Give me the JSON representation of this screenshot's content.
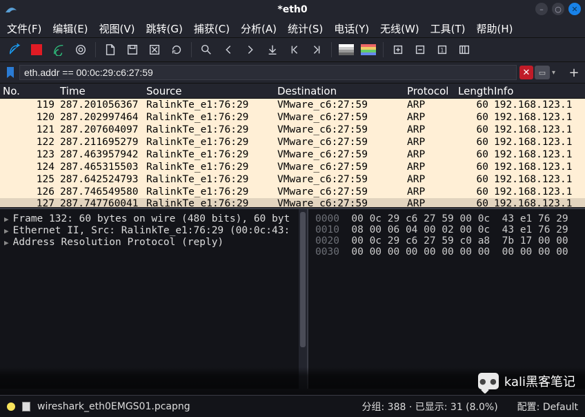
{
  "window": {
    "title": "*eth0"
  },
  "menu": {
    "file": "文件(F)",
    "edit": "编辑(E)",
    "view": "视图(V)",
    "goto": "跳转(G)",
    "capture": "捕获(C)",
    "analyze": "分析(A)",
    "stats": "统计(S)",
    "telephony": "电话(Y)",
    "wireless": "无线(W)",
    "tools": "工具(T)",
    "help": "帮助(H)"
  },
  "filter": {
    "value": "eth.addr == 00:0c:29:c6:27:59"
  },
  "columns": {
    "no": "No.",
    "time": "Time",
    "source": "Source",
    "destination": "Destination",
    "protocol": "Protocol",
    "length": "Length",
    "info": "Info"
  },
  "packets": [
    {
      "no": "119",
      "time": "287.201056367",
      "src": "RalinkTe_e1:76:29",
      "dst": "VMware_c6:27:59",
      "proto": "ARP",
      "len": "60",
      "info": "192.168.123.1"
    },
    {
      "no": "120",
      "time": "287.202997464",
      "src": "RalinkTe_e1:76:29",
      "dst": "VMware_c6:27:59",
      "proto": "ARP",
      "len": "60",
      "info": "192.168.123.1"
    },
    {
      "no": "121",
      "time": "287.207604097",
      "src": "RalinkTe_e1:76:29",
      "dst": "VMware_c6:27:59",
      "proto": "ARP",
      "len": "60",
      "info": "192.168.123.1"
    },
    {
      "no": "122",
      "time": "287.211695279",
      "src": "RalinkTe_e1:76:29",
      "dst": "VMware_c6:27:59",
      "proto": "ARP",
      "len": "60",
      "info": "192.168.123.1"
    },
    {
      "no": "123",
      "time": "287.463957942",
      "src": "RalinkTe_e1:76:29",
      "dst": "VMware_c6:27:59",
      "proto": "ARP",
      "len": "60",
      "info": "192.168.123.1"
    },
    {
      "no": "124",
      "time": "287.465315503",
      "src": "RalinkTe_e1:76:29",
      "dst": "VMware_c6:27:59",
      "proto": "ARP",
      "len": "60",
      "info": "192.168.123.1"
    },
    {
      "no": "125",
      "time": "287.642524793",
      "src": "RalinkTe_e1:76:29",
      "dst": "VMware_c6:27:59",
      "proto": "ARP",
      "len": "60",
      "info": "192.168.123.1"
    },
    {
      "no": "126",
      "time": "287.746549580",
      "src": "RalinkTe_e1:76:29",
      "dst": "VMware_c6:27:59",
      "proto": "ARP",
      "len": "60",
      "info": "192.168.123.1"
    },
    {
      "no": "127",
      "time": "287.747760041",
      "src": "RalinkTe_e1:76:29",
      "dst": "VMware_c6:27:59",
      "proto": "ARP",
      "len": "60",
      "info": "192.168.123.1"
    }
  ],
  "tree": {
    "l1": "Frame 132: 60 bytes on wire (480 bits), 60 byt",
    "l2": "Ethernet II, Src: RalinkTe_e1:76:29 (00:0c:43:",
    "l3": "Address Resolution Protocol (reply)"
  },
  "hex": {
    "r0": {
      "off": "0000",
      "b": "00 0c 29 c6 27 59 00 0c  43 e1 76 29"
    },
    "r1": {
      "off": "0010",
      "b": "08 00 06 04 00 02 00 0c  43 e1 76 29"
    },
    "r2": {
      "off": "0020",
      "b": "00 0c 29 c6 27 59 c0 a8  7b 17 00 00"
    },
    "r3": {
      "off": "0030",
      "b": "00 00 00 00 00 00 00 00  00 00 00 00"
    }
  },
  "overlay": {
    "text": "kali黑客笔记"
  },
  "status": {
    "file": "wireshark_eth0EMGS01.pcapng",
    "packets": "分组: 388 · 已显示: 31 (8.0%)",
    "profile": "配置: Default"
  }
}
